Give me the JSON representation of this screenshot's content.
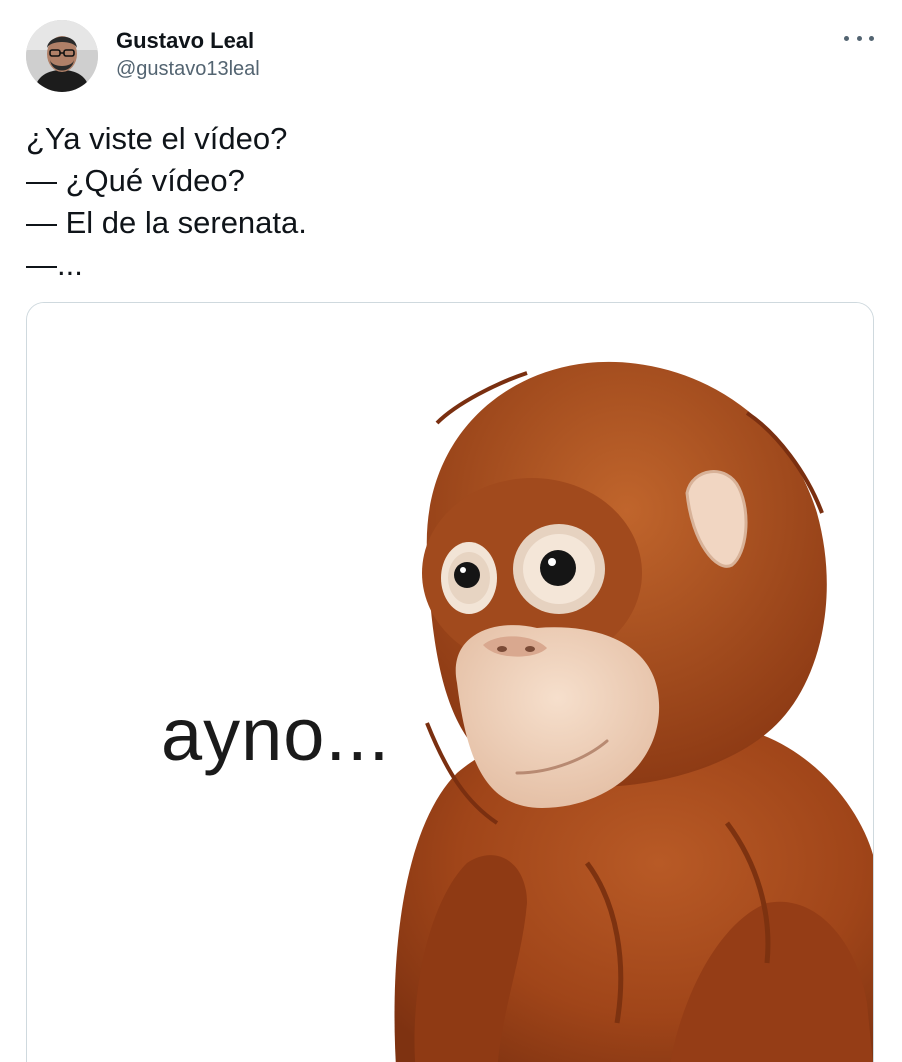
{
  "author": {
    "display_name": "Gustavo Leal",
    "handle": "@gustavo13leal",
    "avatar_icon": "avatar-photo"
  },
  "menu": {
    "icon": "more-horizontal-icon"
  },
  "tweet_text": {
    "lines": [
      "¿Ya viste el vídeo?",
      "— ¿Qué vídeo?",
      "— El de la serenata.",
      "—..."
    ]
  },
  "media": {
    "caption": "ayno...",
    "subject": "orangutan-plush-toy"
  },
  "colors": {
    "text": "#0f1419",
    "secondary": "#536471",
    "border": "#cfd9de",
    "fur": "#a6471b",
    "face": "#f0d2bc"
  }
}
